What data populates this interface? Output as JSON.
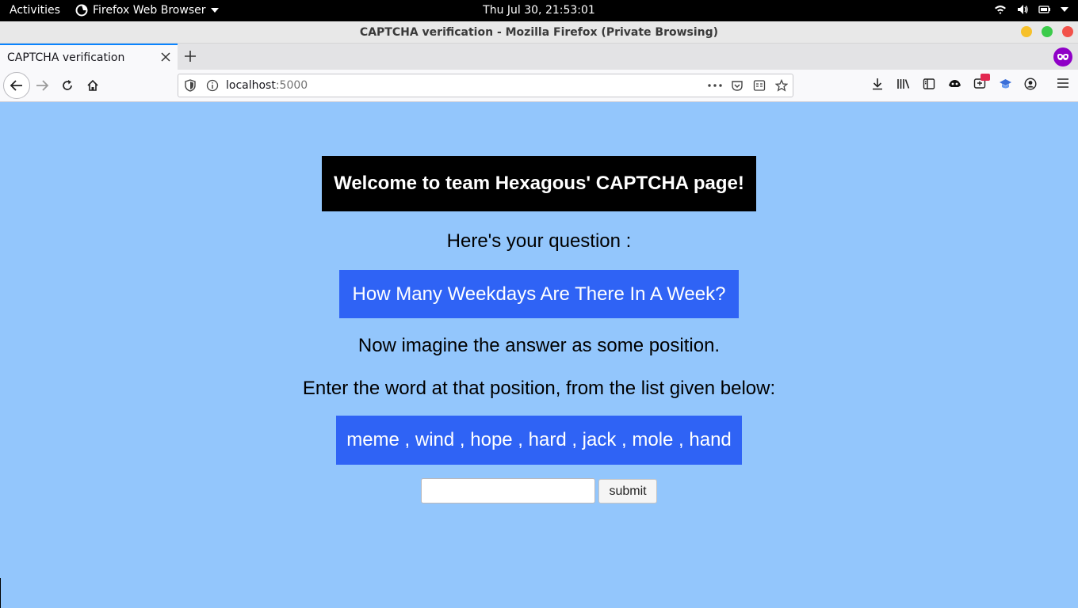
{
  "system": {
    "activities": "Activities",
    "app_name": "Firefox Web Browser",
    "clock": "Thu Jul 30, 21:53:01"
  },
  "window": {
    "title": "CAPTCHA verification - Mozilla Firefox (Private Browsing)"
  },
  "tabs": [
    {
      "label": "CAPTCHA verification",
      "active": true
    }
  ],
  "navbar": {
    "url_host": "localhost",
    "url_port": ":5000",
    "badge_color": "#e22850"
  },
  "page": {
    "background": "#93c6fc",
    "heading": "Welcome to team Hexagous' CAPTCHA page!",
    "question_intro": "Here's your question :",
    "question": "How Many Weekdays Are There In A Week?",
    "instruction_1": "Now imagine the answer as some position.",
    "instruction_2": "Enter the word at that position, from the list given below:",
    "word_list": "meme , wind , hope , hard , jack , mole , hand",
    "answer_value": "",
    "submit_label": "submit"
  }
}
